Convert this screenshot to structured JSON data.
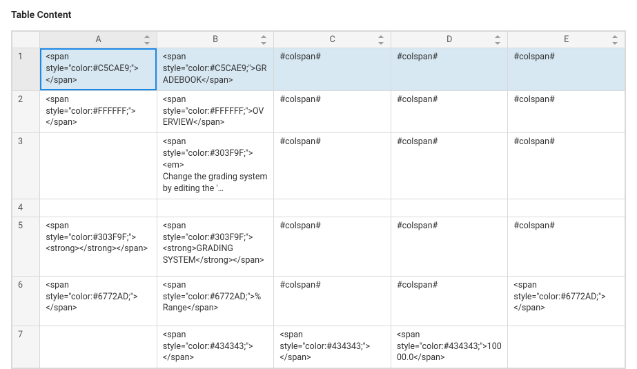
{
  "panel": {
    "title": "Table Content"
  },
  "columns": [
    "A",
    "B",
    "C",
    "D",
    "E"
  ],
  "selected_column_index": 0,
  "active_cell": {
    "row": 0,
    "col": 0
  },
  "rows": [
    {
      "num": "1",
      "selected": true,
      "hclass": "h1",
      "cells": [
        "<span style=\"color:#C5CAE9;\"></span>",
        "<span style=\"color:#C5CAE9;\">GRADEBOOK</span>",
        "#colspan#",
        "#colspan#",
        "#colspan#"
      ]
    },
    {
      "num": "2",
      "selected": false,
      "hclass": "h2",
      "cells": [
        "<span style=\"color:#FFFFFF;\"></span>",
        "<span style=\"color:#FFFFFF;\">OVERVIEW</span>",
        "#colspan#",
        "#colspan#",
        "#colspan#"
      ]
    },
    {
      "num": "3",
      "selected": false,
      "hclass": "h3",
      "cells": [
        "",
        "<span style=\"color:#303F9F;\"><em>\nChange the grading system by editing the '…",
        "#colspan#",
        "#colspan#",
        "#colspan#"
      ]
    },
    {
      "num": "4",
      "selected": false,
      "hclass": "h4",
      "cells": [
        "",
        "",
        "",
        "",
        ""
      ]
    },
    {
      "num": "5",
      "selected": false,
      "hclass": "h5",
      "cells": [
        "<span style=\"color:#303F9F;\"><strong></strong></span>",
        "<span style=\"color:#303F9F;\"><strong>GRADING SYSTEM</strong></span>",
        "#colspan#",
        "#colspan#",
        "#colspan#"
      ]
    },
    {
      "num": "6",
      "selected": false,
      "hclass": "h6",
      "cells": [
        "<span style=\"color:#6772AD;\"></span>",
        "<span style=\"color:#6772AD;\">% Range</span>",
        "#colspan#",
        "#colspan#",
        "<span style=\"color:#6772AD;\"></span>"
      ]
    },
    {
      "num": "7",
      "selected": false,
      "hclass": "h7",
      "cells": [
        "",
        "<span style=\"color:#434343;\"></span>",
        "<span style=\"color:#434343;\"></span>",
        "<span style=\"color:#434343;\">10000.0</span>",
        ""
      ]
    }
  ]
}
